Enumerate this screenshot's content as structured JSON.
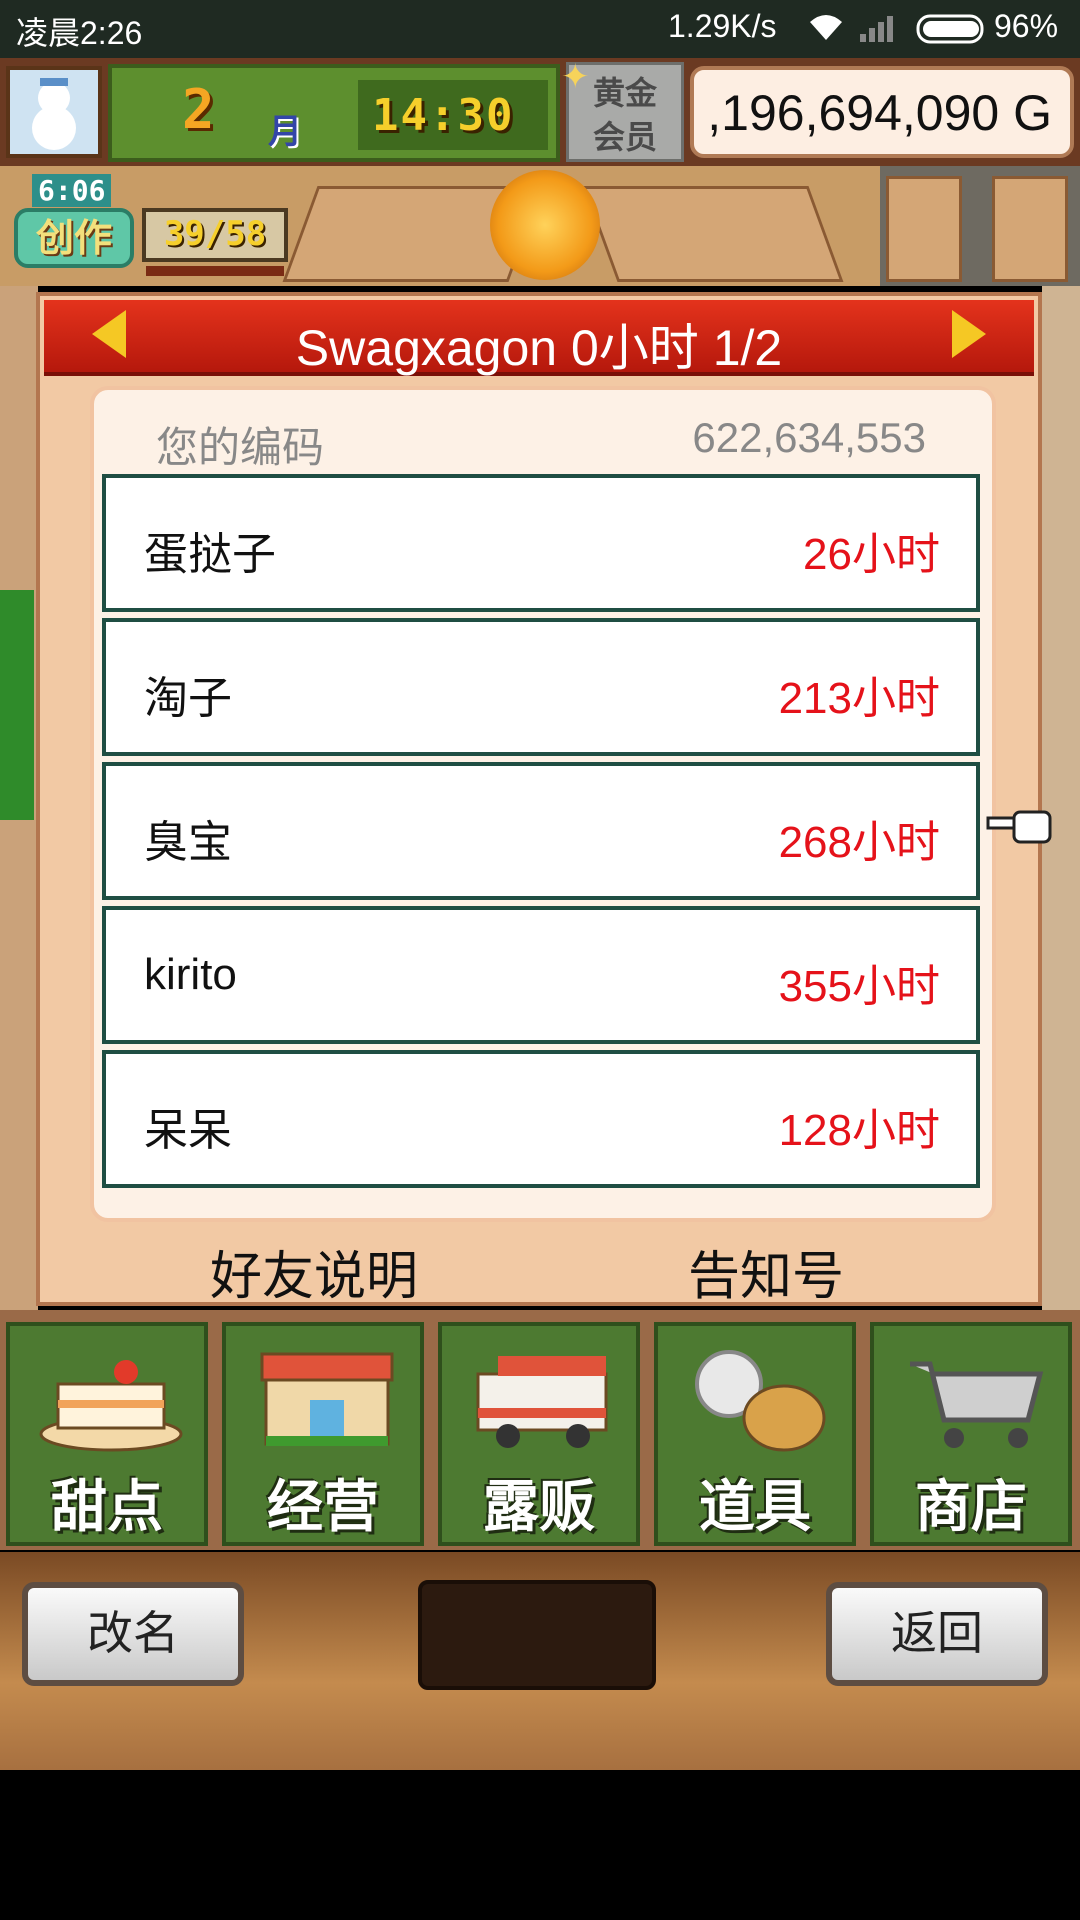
{
  "status_bar": {
    "time": "凌晨2:26",
    "speed": "1.29K/s",
    "battery": "96%"
  },
  "top_bar": {
    "month_number": "2",
    "month_label": "月",
    "clock": "14:30",
    "member_badge": "黄金会员",
    "gold": ",196,694,090 G"
  },
  "create_badge": {
    "time": "6:06",
    "label": "创作",
    "count": "39/58"
  },
  "panel": {
    "title": "Swagxagon  0小时 1/2",
    "code_label": "您的编码",
    "code_value": "622,634,553",
    "friends": [
      {
        "name": "蛋挞子",
        "hours": "26小时"
      },
      {
        "name": "淘子",
        "hours": "213小时"
      },
      {
        "name": "臭宝",
        "hours": "268小时"
      },
      {
        "name": "kirito",
        "hours": "355小时"
      },
      {
        "name": "呆呆",
        "hours": "128小时"
      }
    ],
    "friend_help": "好友说明",
    "notice": "告知号"
  },
  "nav": {
    "items": [
      {
        "label": "甜点",
        "icon": "cake-icon"
      },
      {
        "label": "经营",
        "icon": "shop-building-icon"
      },
      {
        "label": "露贩",
        "icon": "food-truck-icon"
      },
      {
        "label": "道具",
        "icon": "item-bag-icon"
      },
      {
        "label": "商店",
        "icon": "shopping-cart-icon"
      }
    ]
  },
  "bottom": {
    "rename": "改名",
    "back": "返回"
  },
  "colors": {
    "header_red": "#c8200f",
    "hours_red": "#e5121a",
    "row_border": "#1f4e43",
    "nav_green": "#4d7a31"
  }
}
